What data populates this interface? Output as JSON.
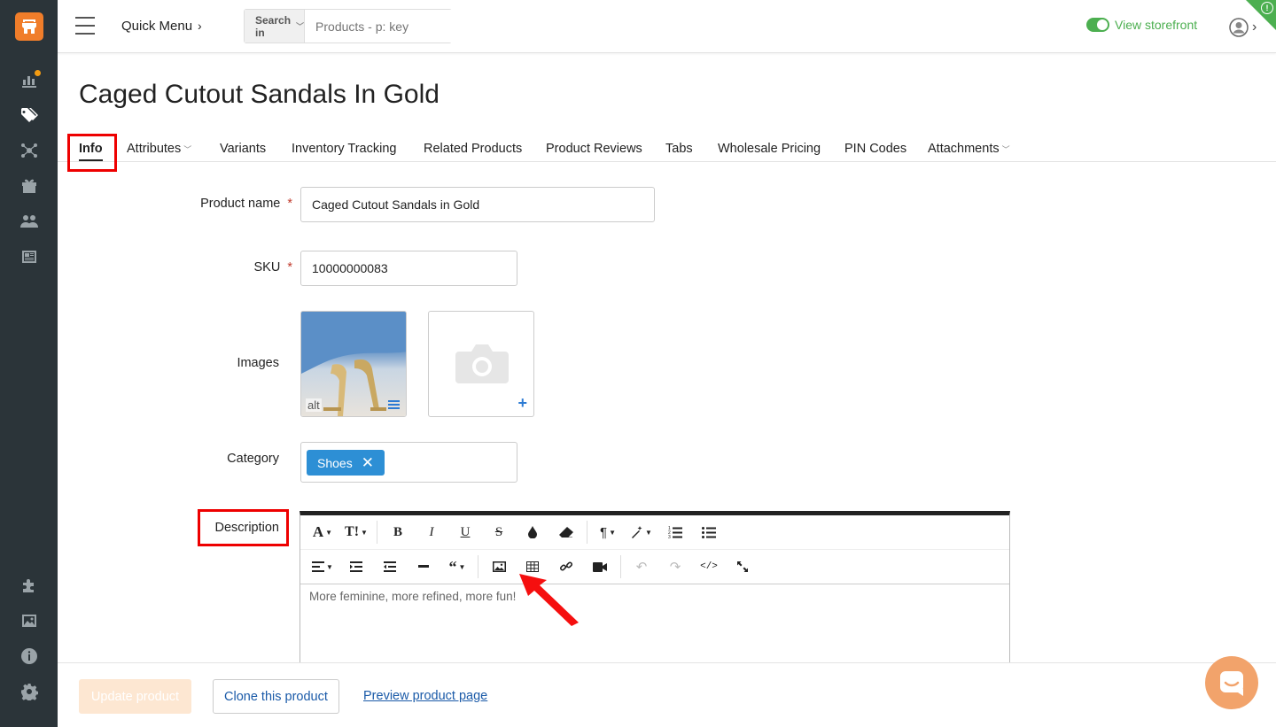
{
  "header": {
    "quick_menu": "Quick Menu",
    "search_in": "Search in",
    "search_placeholder": "Products - p: key",
    "view_storefront": "View storefront"
  },
  "page_title": "Caged Cutout Sandals In Gold",
  "tabs": [
    {
      "label": "Info",
      "active": true
    },
    {
      "label": "Attributes",
      "dropdown": true
    },
    {
      "label": "Variants"
    },
    {
      "label": "Inventory Tracking"
    },
    {
      "label": "Related Products"
    },
    {
      "label": "Product Reviews"
    },
    {
      "label": "Tabs"
    },
    {
      "label": "Wholesale Pricing"
    },
    {
      "label": "PIN Codes"
    },
    {
      "label": "Attachments",
      "dropdown": true
    }
  ],
  "form": {
    "product_name_label": "Product name",
    "product_name_value": "Caged Cutout Sandals in Gold",
    "sku_label": "SKU",
    "sku_value": "10000000083",
    "images_label": "Images",
    "image_alt": "alt",
    "category_label": "Category",
    "category_chip": "Shoes",
    "description_label": "Description",
    "description_text": "More feminine, more refined, more fun!",
    "required_mark": "*"
  },
  "editor_toolbar": {
    "row1": [
      "font-family",
      "font-size",
      "bold",
      "italic",
      "underline",
      "strikethrough",
      "color",
      "eraser",
      "paragraph",
      "style",
      "ordered-list",
      "unordered-list"
    ],
    "row2": [
      "align",
      "indent",
      "outdent",
      "hr",
      "quote",
      "image",
      "table",
      "link",
      "video",
      "undo",
      "redo",
      "code",
      "fullscreen"
    ]
  },
  "footer": {
    "update_button": "Update product",
    "clone_button": "Clone this product",
    "preview_link": "Preview product page"
  },
  "colors": {
    "sidebar": "#2b3439",
    "accent_orange": "#f07d2a",
    "storefront_green": "#4caf50",
    "chip_blue": "#2d8fd5",
    "highlight_red": "#e00"
  }
}
